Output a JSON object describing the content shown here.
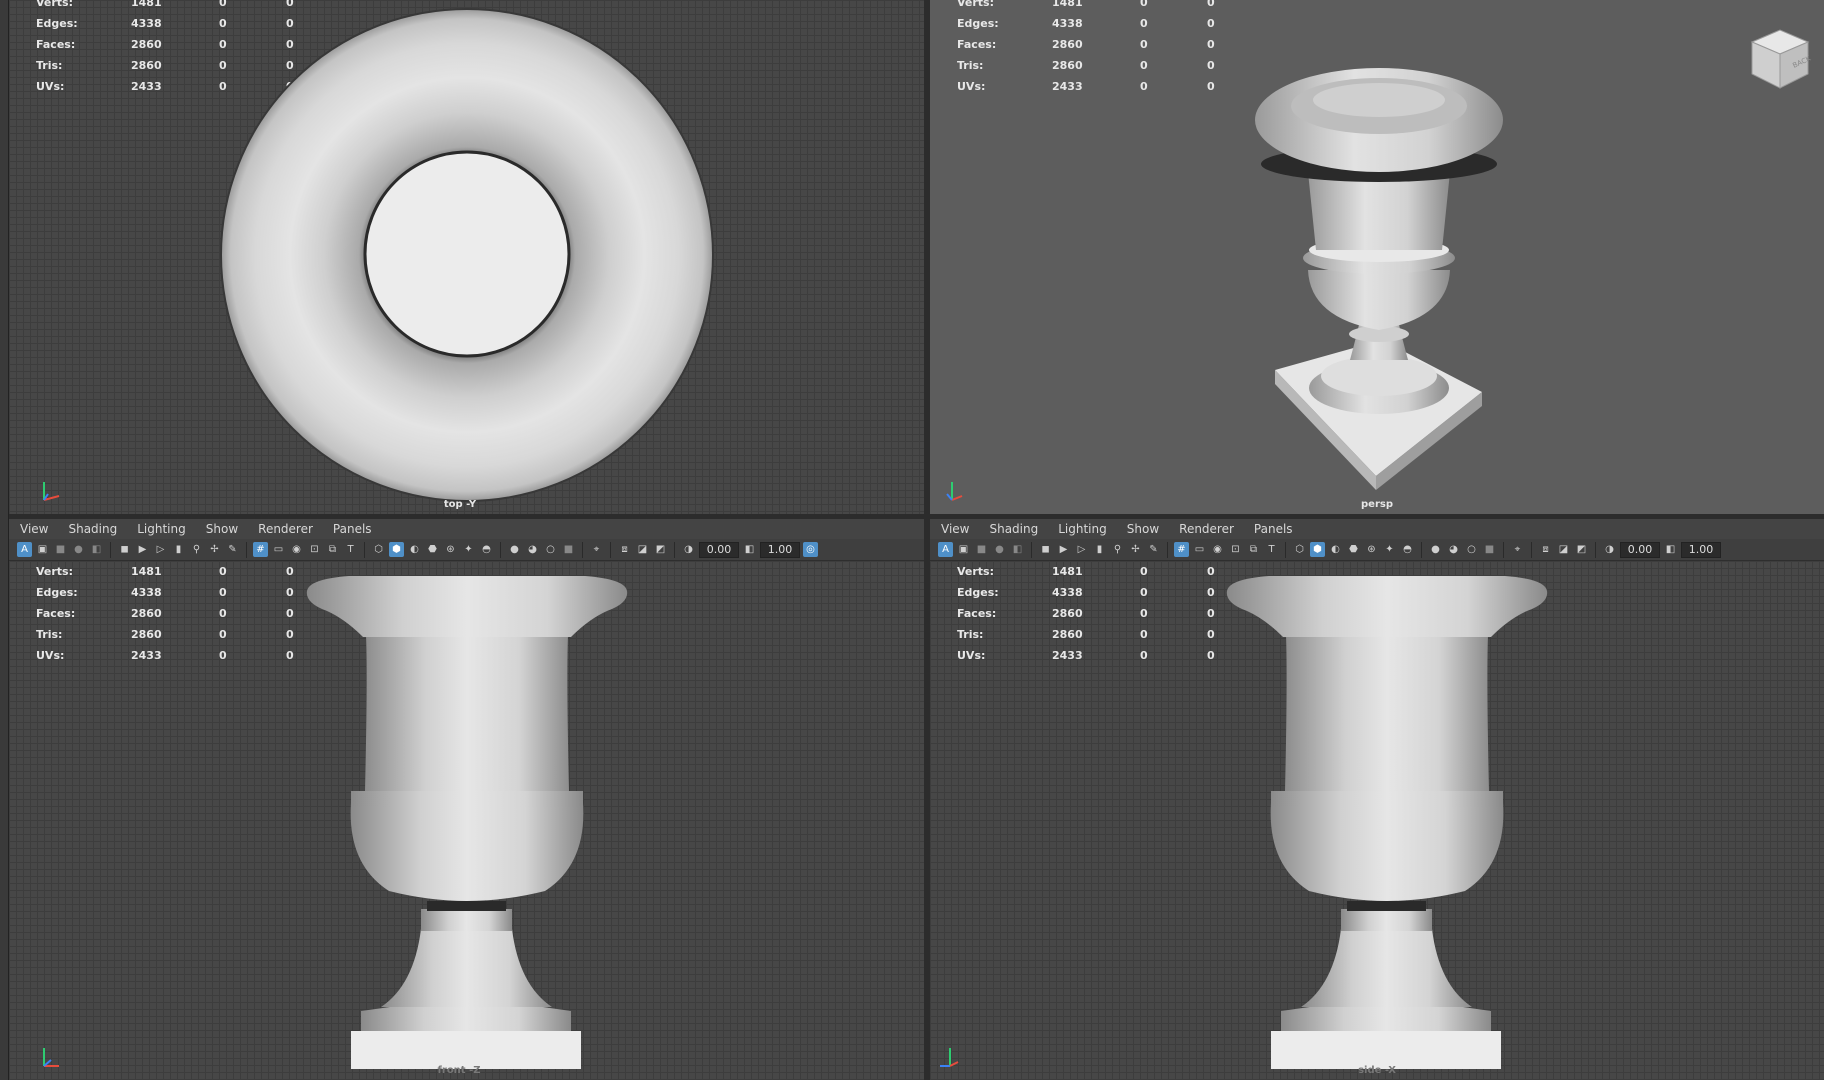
{
  "menu": {
    "view": "View",
    "shading": "Shading",
    "lighting": "Lighting",
    "show": "Show",
    "renderer": "Renderer",
    "panels": "Panels"
  },
  "toolbar": {
    "field_a": "0.00",
    "field_b": "1.00"
  },
  "stats": {
    "labels": [
      "Verts:",
      "Edges:",
      "Faces:",
      "Tris:",
      "UVs:"
    ],
    "values": [
      "1481",
      "4338",
      "2860",
      "2860",
      "2433"
    ],
    "zeros": [
      "0",
      "0",
      "0",
      "0",
      "0"
    ]
  },
  "viewports": {
    "top": {
      "camera": "top -Y"
    },
    "persp": {
      "camera": "persp",
      "cube_face": "BACK"
    },
    "front": {
      "camera": "front -Z"
    },
    "side": {
      "camera": "side -X"
    }
  },
  "colors": {
    "accent": "#4f90c8",
    "grid_bg": "#474747",
    "persp_bg": "#5d5d5d"
  }
}
